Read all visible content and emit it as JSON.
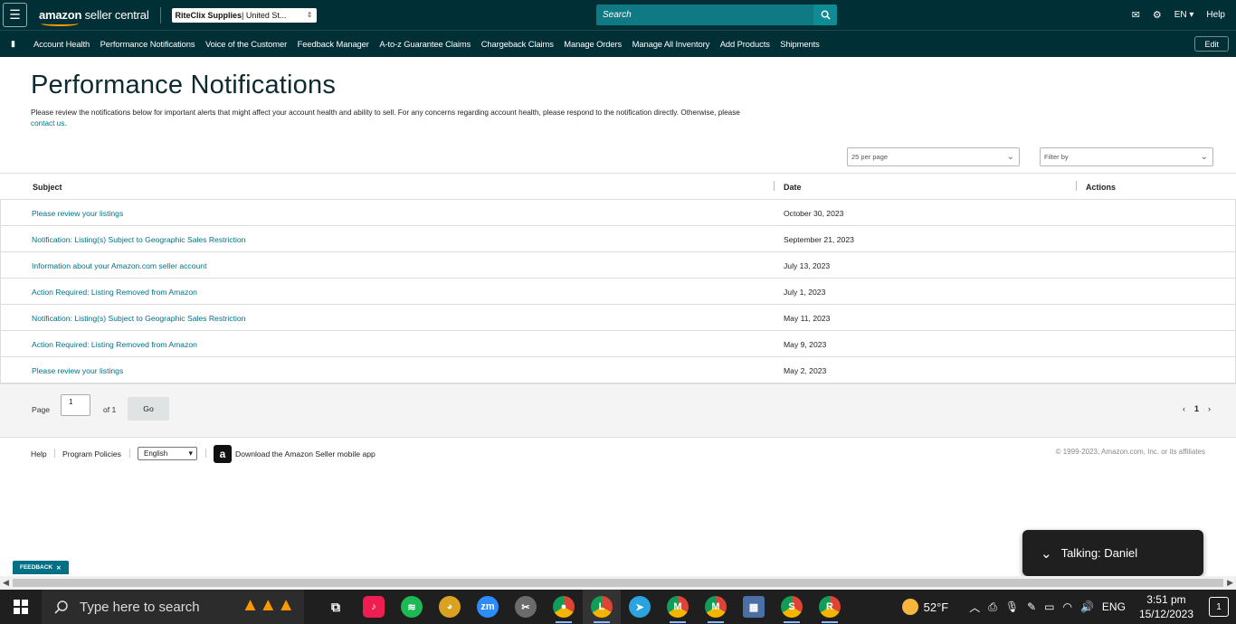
{
  "topbar": {
    "logo_text_bold": "amazon",
    "logo_text": " seller central",
    "store_name_bold": "RiteClix Supplies",
    "store_name_rest": " | United St...",
    "search_placeholder": "Search",
    "language": "EN",
    "help": "Help"
  },
  "nav": {
    "items": [
      "Account Health",
      "Performance Notifications",
      "Voice of the Customer",
      "Feedback Manager",
      "A-to-z Guarantee Claims",
      "Chargeback Claims",
      "Manage Orders",
      "Manage All Inventory",
      "Add Products",
      "Shipments"
    ],
    "edit_label": "Edit"
  },
  "page": {
    "title": "Performance Notifications",
    "description": "Please review the notifications below for important alerts that might affect your account health and ability to sell. For any concerns regarding account health, please respond to the notification directly. Otherwise, please",
    "contact_link": "contact us.",
    "per_page": "25 per page",
    "filter_placeholder": "Filter by"
  },
  "table": {
    "headers": {
      "subject": "Subject",
      "date": "Date",
      "actions": "Actions"
    },
    "rows": [
      {
        "subject": "Please review your listings",
        "date": "October 30, 2023"
      },
      {
        "subject": "Notification: Listing(s) Subject to Geographic Sales Restriction",
        "date": "September 21, 2023"
      },
      {
        "subject": "Information about your Amazon.com seller account",
        "date": "July 13, 2023"
      },
      {
        "subject": "Action Required: Listing Removed from Amazon",
        "date": "July 1, 2023"
      },
      {
        "subject": "Notification: Listing(s) Subject to Geographic Sales Restriction",
        "date": "May 11, 2023"
      },
      {
        "subject": "Action Required: Listing Removed from Amazon",
        "date": "May 9, 2023"
      },
      {
        "subject": "Please review your listings",
        "date": "May 2, 2023"
      }
    ]
  },
  "pager": {
    "page_label": "Page",
    "page_value": "1",
    "of_label": "of 1",
    "go_label": "Go",
    "current": "1"
  },
  "footer": {
    "help": "Help",
    "program_policies": "Program Policies",
    "language": "English",
    "app_download": "Download the Amazon Seller mobile app",
    "copyright": "© 1999-2023, Amazon.com, Inc. or its affiliates"
  },
  "feedback_label": "FEEDBACK",
  "toast": {
    "text": "Talking: Daniel"
  },
  "taskbar": {
    "search_placeholder": "Type here to search",
    "apps": [
      {
        "name": "task-view",
        "label": "",
        "color": "#1f1f1f"
      },
      {
        "name": "tiktok",
        "label": "♪",
        "color": "#ee1d52"
      },
      {
        "name": "spotify",
        "label": "≋",
        "color": "#1db954"
      },
      {
        "name": "game",
        "label": "◕",
        "color": "#d9a321"
      },
      {
        "name": "zoom",
        "label": "zm",
        "color": "#2d8cff"
      },
      {
        "name": "snip",
        "label": "✂",
        "color": "#6b6b6b"
      },
      {
        "name": "chrome-1",
        "label": "●",
        "color": "#db4437"
      },
      {
        "name": "chrome-l",
        "label": "L",
        "color": "#0f9d58"
      },
      {
        "name": "telegram",
        "label": "➤",
        "color": "#2aa3df"
      },
      {
        "name": "chrome-m1",
        "label": "M",
        "color": "#0f9d58"
      },
      {
        "name": "chrome-m2",
        "label": "M",
        "color": "#f4b400"
      },
      {
        "name": "calculator",
        "label": "▦",
        "color": "#4a6fa5"
      },
      {
        "name": "chrome-s",
        "label": "S",
        "color": "#db4437"
      },
      {
        "name": "chrome-r",
        "label": "R",
        "color": "#7b3fa0"
      }
    ],
    "temperature": "52°F",
    "lang": "ENG",
    "time": "3:51 pm",
    "date": "15/12/2023",
    "notifications": "1"
  },
  "colors": {
    "header_bg": "#002f36",
    "link": "#007185",
    "search_bg": "#0f7a83"
  }
}
